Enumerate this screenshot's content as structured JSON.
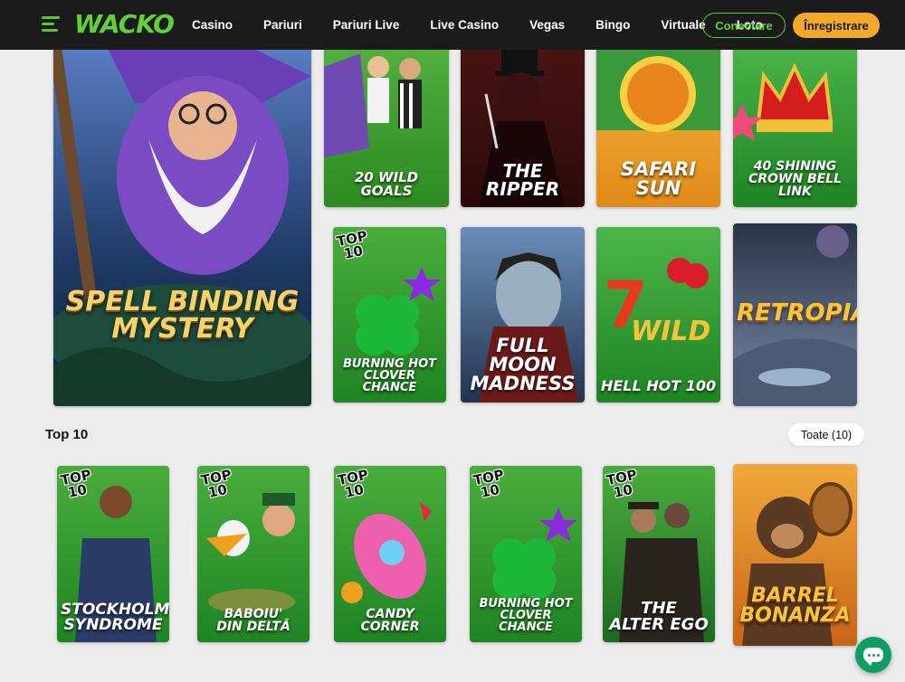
{
  "header": {
    "logo": "WACKO",
    "nav": [
      "Casino",
      "Pariuri",
      "Pariuri Live",
      "Live Casino",
      "Vegas",
      "Bingo",
      "Virtuale",
      "Loto"
    ],
    "login_label": "Conectare",
    "register_label": "Înregistrare"
  },
  "featured": {
    "big_title": "SPELL BINDING\nMYSTERY",
    "row1": [
      "20 WILD GOALS",
      "THE\nRIPPER",
      "SAFARI\nSUN",
      "40 SHINING\nCROWN BELL LINK"
    ],
    "row2": [
      "BURNING HOT\nCLOVER CHANCE",
      "FULL MOON\nMADNESS",
      "HELL HOT 100",
      "RETROPIA"
    ]
  },
  "top10": {
    "title": "Top 10",
    "all_label": "Toate (10)",
    "badge_line1": "TOP",
    "badge_line2": "10",
    "games": [
      "STOCKHOLM\nSYNDROME",
      "BABOIU'\nDIN DELTĂ",
      "CANDY CORNER",
      "BURNING HOT\nCLOVER CHANCE",
      "THE\nALTER EGO",
      "BARREL\nBONANZA"
    ]
  },
  "colors": {
    "accent": "#5fd23a",
    "register": "#f0a92b",
    "header_bg": "#1b1b1b",
    "chat": "#0e9e64"
  }
}
